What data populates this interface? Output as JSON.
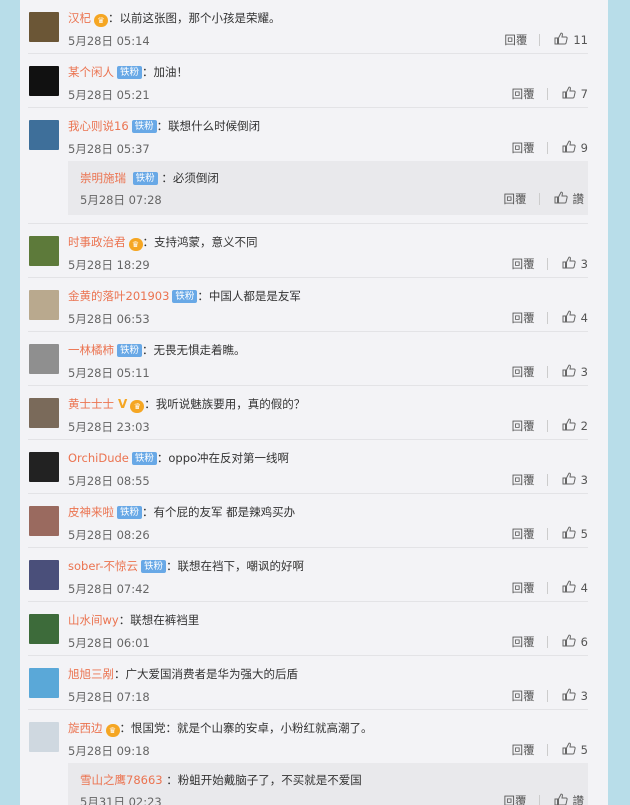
{
  "labels": {
    "reply": "回覆",
    "like_zan": "讚"
  },
  "comments": [
    {
      "user": "汉杞",
      "badge": "",
      "vip": true,
      "vmark": false,
      "text": "：以前这张图，那个小孩是荣耀。",
      "time": "5月28日 05:14",
      "likes": "11",
      "avatar_color": "#6b5636"
    },
    {
      "user": "某个闲人",
      "badge": "铁粉",
      "vip": false,
      "vmark": false,
      "text": "：加油！",
      "time": "5月28日 05:21",
      "likes": "7",
      "avatar_color": "#111111"
    },
    {
      "user": "我心则说16",
      "badge": "铁粉",
      "vip": false,
      "vmark": false,
      "text": "：联想什么时候倒闭",
      "time": "5月28日 05:37",
      "likes": "9",
      "avatar_color": "#3e6f9a",
      "reply": {
        "user": "崇明施瑞",
        "badge": "铁粉",
        "text": "：必须倒闭",
        "time": "5月28日 07:28"
      }
    },
    {
      "user": "时事政治君",
      "badge": "",
      "vip": true,
      "vmark": false,
      "text": "：支持鸿蒙，意义不同",
      "time": "5月28日 18:29",
      "likes": "3",
      "avatar_color": "#5d7a3a"
    },
    {
      "user": "金黄的落叶201903",
      "badge": "铁粉",
      "vip": false,
      "vmark": false,
      "text": "：中国人都是是友军",
      "time": "5月28日 06:53",
      "likes": "4",
      "avatar_color": "#b9a98e"
    },
    {
      "user": "一林橘柿",
      "badge": "铁粉",
      "vip": false,
      "vmark": false,
      "text": "：无畏无惧走着瞧。",
      "time": "5月28日 05:11",
      "likes": "3",
      "avatar_color": "#8f8f8f"
    },
    {
      "user": "黄士士士",
      "badge": "",
      "vip": true,
      "vmark": true,
      "text": "：我听说魅族要用，真的假的？",
      "time": "5月28日 23:03",
      "likes": "2",
      "avatar_color": "#7a6a5a"
    },
    {
      "user": "OrchiDude",
      "badge": "铁粉",
      "vip": false,
      "vmark": false,
      "text": "：oppo冲在反对第一线啊",
      "time": "5月28日 08:55",
      "likes": "3",
      "avatar_color": "#222222"
    },
    {
      "user": "皮神来啦",
      "badge": "铁粉",
      "vip": false,
      "vmark": false,
      "text": "：有个屁的友军 都是辣鸡买办",
      "time": "5月28日 08:26",
      "likes": "5",
      "avatar_color": "#9a6a5f"
    },
    {
      "user": "sober-不惊云",
      "badge": "铁粉",
      "vip": false,
      "vmark": false,
      "text": "：联想在裆下，嘲讽的好啊",
      "time": "5月28日 07:42",
      "likes": "4",
      "avatar_color": "#4a4f7a"
    },
    {
      "user": "山水间wy",
      "badge": "",
      "vip": false,
      "vmark": false,
      "text": "：联想在裤裆里",
      "time": "5月28日 06:01",
      "likes": "6",
      "avatar_color": "#3d6b3a"
    },
    {
      "user": "旭旭三剐",
      "badge": "",
      "vip": false,
      "vmark": false,
      "text": "：广大爱国消费者是华为强大的后盾",
      "time": "5月28日 07:18",
      "likes": "3",
      "avatar_color": "#5aa8d8"
    },
    {
      "user": "旋西边",
      "badge": "",
      "vip": true,
      "vmark": false,
      "text": "：恨国党：就是个山寨的安卓，小粉红就高潮了。",
      "time": "5月28日 09:18",
      "likes": "5",
      "avatar_color": "#cfd8e0",
      "reply": {
        "user": "雪山之鹰78663",
        "badge": "",
        "text": "：粉蛆开始戴脑子了，不买就是不爱国",
        "time": "5月31日 02:23"
      }
    }
  ]
}
